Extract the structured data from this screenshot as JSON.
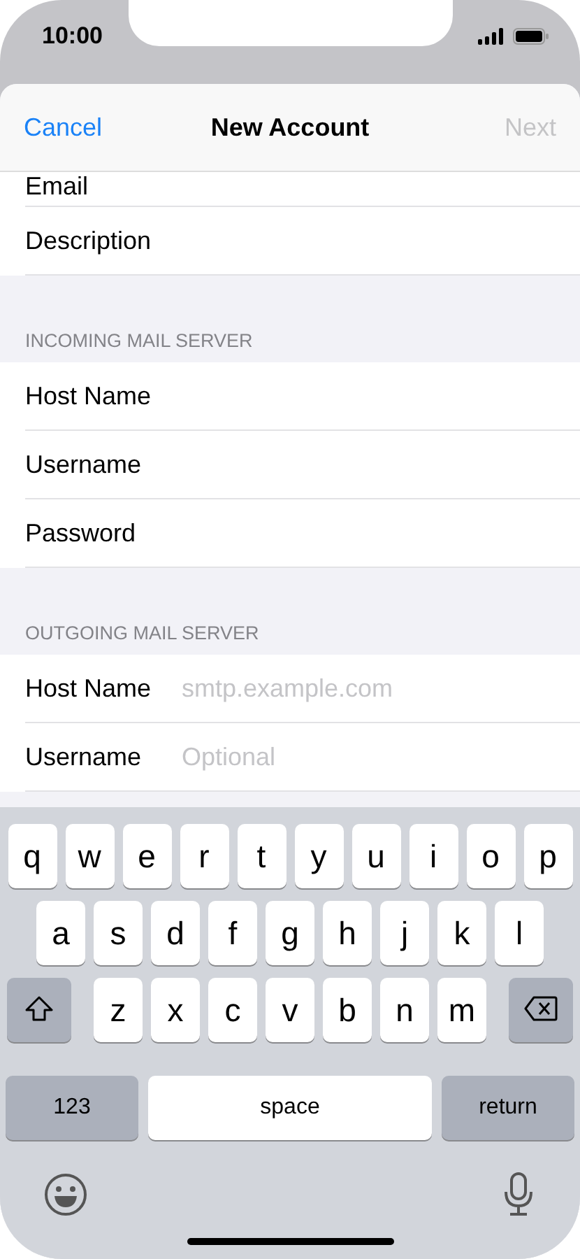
{
  "status_bar": {
    "time": "10:00"
  },
  "nav": {
    "cancel": "Cancel",
    "title": "New Account",
    "next": "Next",
    "next_disabled": true
  },
  "cut_row": {
    "label": "Email"
  },
  "top_rows": [
    {
      "label": "Description"
    }
  ],
  "sections": [
    {
      "header": "INCOMING MAIL SERVER",
      "rows": [
        {
          "label": "Host Name"
        },
        {
          "label": "Username"
        },
        {
          "label": "Password"
        }
      ]
    },
    {
      "header": "OUTGOING MAIL SERVER",
      "rows": [
        {
          "label": "Host Name",
          "placeholder": "smtp.example.com"
        },
        {
          "label": "Username",
          "placeholder": "Optional"
        }
      ]
    }
  ],
  "keyboard": {
    "key_rows": [
      {
        "keys": [
          {
            "kind": "letter",
            "label": "q"
          },
          {
            "kind": "letter",
            "label": "w"
          },
          {
            "kind": "letter",
            "label": "e"
          },
          {
            "kind": "letter",
            "label": "r"
          },
          {
            "kind": "letter",
            "label": "t"
          },
          {
            "kind": "letter",
            "label": "y"
          },
          {
            "kind": "letter",
            "label": "u"
          },
          {
            "kind": "letter",
            "label": "i"
          },
          {
            "kind": "letter",
            "label": "o"
          },
          {
            "kind": "letter",
            "label": "p"
          }
        ]
      },
      {
        "keys": [
          {
            "kind": "letter",
            "label": "a"
          },
          {
            "kind": "letter",
            "label": "s"
          },
          {
            "kind": "letter",
            "label": "d"
          },
          {
            "kind": "letter",
            "label": "f"
          },
          {
            "kind": "letter",
            "label": "g"
          },
          {
            "kind": "letter",
            "label": "h"
          },
          {
            "kind": "letter",
            "label": "j"
          },
          {
            "kind": "letter",
            "label": "k"
          },
          {
            "kind": "letter",
            "label": "l"
          }
        ]
      },
      {
        "keys": [
          {
            "kind": "shift"
          },
          {
            "kind": "letter",
            "label": "z"
          },
          {
            "kind": "letter",
            "label": "x"
          },
          {
            "kind": "letter",
            "label": "c"
          },
          {
            "kind": "letter",
            "label": "v"
          },
          {
            "kind": "letter",
            "label": "b"
          },
          {
            "kind": "letter",
            "label": "n"
          },
          {
            "kind": "letter",
            "label": "m"
          },
          {
            "kind": "delete"
          }
        ]
      },
      {
        "keys": [
          {
            "kind": "mode",
            "label": "123"
          },
          {
            "kind": "space",
            "label": "space"
          },
          {
            "kind": "mode",
            "label": "return"
          }
        ]
      }
    ]
  }
}
